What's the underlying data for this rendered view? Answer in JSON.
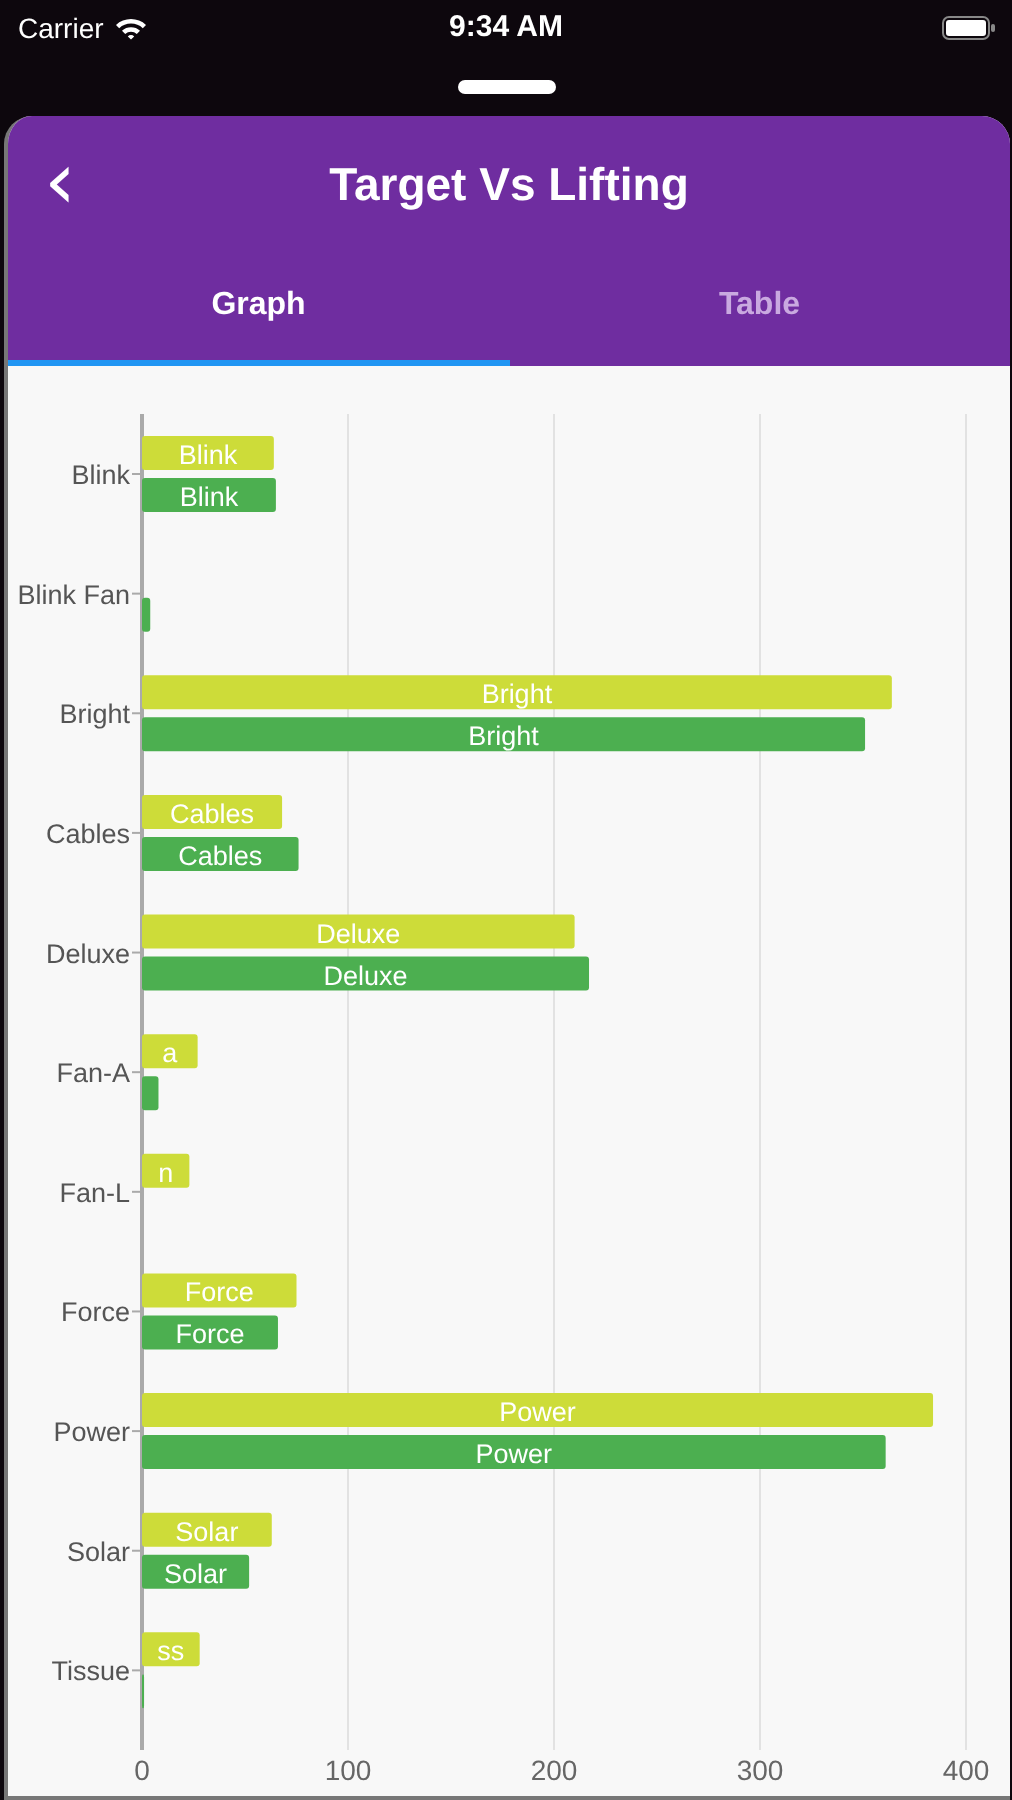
{
  "status_bar": {
    "carrier": "Carrier",
    "time": "9:34 AM"
  },
  "header": {
    "title": "Target Vs Lifting",
    "back_icon": "‹"
  },
  "tabs": [
    {
      "label": "Graph",
      "selected": true
    },
    {
      "label": "Table",
      "selected": false
    }
  ],
  "chart": {
    "chart_data": {
      "type": "bar",
      "orientation": "horizontal",
      "grid": true,
      "categories": [
        "Blink",
        "Blink Fan",
        "Bright",
        "Cables",
        "Deluxe",
        "Fan-A",
        "Fan-L",
        "Force",
        "Power",
        "Solar",
        "Tissue"
      ],
      "series": [
        {
          "color": "#cddc39",
          "values": [
            64,
            0,
            364,
            68,
            210,
            27,
            23,
            75,
            384,
            63,
            28
          ]
        },
        {
          "color": "#4caf50",
          "values": [
            65,
            4,
            351,
            76,
            217,
            8,
            0,
            66,
            361,
            52,
            1
          ]
        }
      ],
      "annotations": [
        "Blink",
        "Blink",
        "Bright",
        "Bright",
        "Cables",
        "Cables",
        "Deluxe",
        "Deluxe",
        "a",
        "n",
        "Force",
        "Force",
        "Power",
        "Power",
        "Solar",
        "Solar",
        "ss"
      ],
      "xlim": [
        0,
        400
      ],
      "xticks": [
        0,
        100,
        200,
        300,
        400
      ]
    }
  }
}
